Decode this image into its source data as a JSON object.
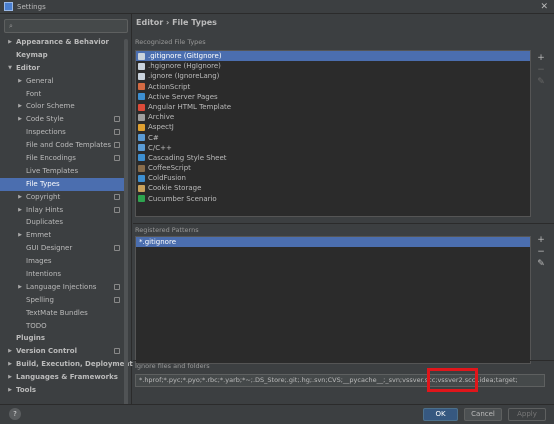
{
  "window": {
    "title": "Settings",
    "close_glyph": "✕"
  },
  "search": {
    "placeholder": ""
  },
  "sidebar": {
    "items": [
      {
        "label": "Appearance & Behavior",
        "level": 0,
        "arrow": "▶",
        "bold": true
      },
      {
        "label": "Keymap",
        "level": 0,
        "arrow": "",
        "bold": true
      },
      {
        "label": "Editor",
        "level": 0,
        "arrow": "▼",
        "bold": true
      },
      {
        "label": "General",
        "level": 1,
        "arrow": "▶"
      },
      {
        "label": "Font",
        "level": 1,
        "arrow": ""
      },
      {
        "label": "Color Scheme",
        "level": 1,
        "arrow": "▶"
      },
      {
        "label": "Code Style",
        "level": 1,
        "arrow": "▶",
        "project_icon": true
      },
      {
        "label": "Inspections",
        "level": 1,
        "arrow": "",
        "project_icon": true
      },
      {
        "label": "File and Code Templates",
        "level": 1,
        "arrow": "",
        "project_icon": true
      },
      {
        "label": "File Encodings",
        "level": 1,
        "arrow": "",
        "project_icon": true
      },
      {
        "label": "Live Templates",
        "level": 1,
        "arrow": ""
      },
      {
        "label": "File Types",
        "level": 1,
        "arrow": "",
        "selected": true
      },
      {
        "label": "Copyright",
        "level": 1,
        "arrow": "▶",
        "project_icon": true
      },
      {
        "label": "Inlay Hints",
        "level": 1,
        "arrow": "▶",
        "project_icon": true
      },
      {
        "label": "Duplicates",
        "level": 1,
        "arrow": ""
      },
      {
        "label": "Emmet",
        "level": 1,
        "arrow": "▶"
      },
      {
        "label": "GUI Designer",
        "level": 1,
        "arrow": "",
        "project_icon": true
      },
      {
        "label": "Images",
        "level": 1,
        "arrow": ""
      },
      {
        "label": "Intentions",
        "level": 1,
        "arrow": ""
      },
      {
        "label": "Language Injections",
        "level": 1,
        "arrow": "▶",
        "project_icon": true
      },
      {
        "label": "Spelling",
        "level": 1,
        "arrow": "",
        "project_icon": true
      },
      {
        "label": "TextMate Bundles",
        "level": 1,
        "arrow": ""
      },
      {
        "label": "TODO",
        "level": 1,
        "arrow": ""
      },
      {
        "label": "Plugins",
        "level": 0,
        "arrow": "",
        "bold": true
      },
      {
        "label": "Version Control",
        "level": 0,
        "arrow": "▶",
        "bold": true,
        "project_icon": true
      },
      {
        "label": "Build, Execution, Deployment",
        "level": 0,
        "arrow": "▶",
        "bold": true
      },
      {
        "label": "Languages & Frameworks",
        "level": 0,
        "arrow": "▶",
        "bold": true
      },
      {
        "label": "Tools",
        "level": 0,
        "arrow": "▶",
        "bold": true
      }
    ]
  },
  "breadcrumb": {
    "parent": "Editor",
    "separator": "›",
    "current": "File Types"
  },
  "recognized": {
    "label": "Recognized File Types",
    "items": [
      {
        "label": ".gitignore (GitIgnore)",
        "color": "#c9d2dc",
        "selected": true
      },
      {
        "label": ".hgignore (HgIgnore)",
        "color": "#c9d2dc"
      },
      {
        "label": ".ignore (IgnoreLang)",
        "color": "#c9d2dc"
      },
      {
        "label": "ActionScript",
        "color": "#d46a43"
      },
      {
        "label": "Active Server Pages",
        "color": "#3d8fd1"
      },
      {
        "label": "Angular HTML Template",
        "color": "#dd4b39"
      },
      {
        "label": "Archive",
        "color": "#9e9e9e"
      },
      {
        "label": "AspectJ",
        "color": "#e0a030"
      },
      {
        "label": "C#",
        "color": "#5a9bd5"
      },
      {
        "label": "C/C++",
        "color": "#5a9bd5"
      },
      {
        "label": "Cascading Style Sheet",
        "color": "#3d8fd1"
      },
      {
        "label": "CoffeeScript",
        "color": "#8a6d4b"
      },
      {
        "label": "ColdFusion",
        "color": "#3d8fd1"
      },
      {
        "label": "Cookie Storage",
        "color": "#c9a15b"
      },
      {
        "label": "Cucumber Scenario",
        "color": "#2ea44f"
      }
    ],
    "tools": {
      "add": "+",
      "remove": "−",
      "edit": "✎"
    }
  },
  "patterns": {
    "label": "Registered Patterns",
    "items": [
      "*.gitignore"
    ],
    "tools": {
      "add": "+",
      "remove": "−",
      "edit": "✎"
    }
  },
  "ignore": {
    "label": "Ignore files and folders",
    "value": "*.hprof;*.pyc;*.pyo;*.rbc;*.yarb;*~;.DS_Store;.git;.hg;.svn;CVS;__pycache__;_svn;vssver.scc;vssver2.scc;.idea;target;"
  },
  "buttons": {
    "help": "?",
    "ok": "OK",
    "cancel": "Cancel",
    "apply": "Apply"
  },
  "colors": {
    "accent": "#4b6eaf",
    "ok_button": "#365880",
    "highlight": "#e0161b"
  }
}
